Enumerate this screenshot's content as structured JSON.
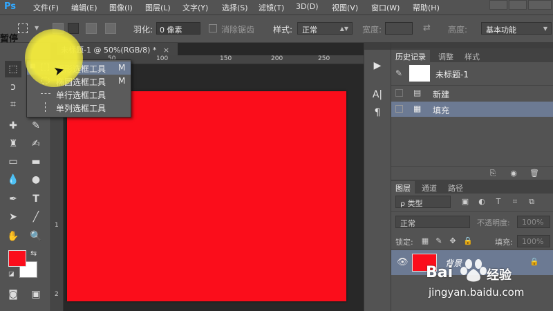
{
  "app": {
    "logo": "Ps",
    "menu": [
      "文件(F)",
      "编辑(E)",
      "图像(I)",
      "图层(L)",
      "文字(Y)",
      "选择(S)",
      "滤镜(T)",
      "3D(D)",
      "视图(V)",
      "窗口(W)",
      "帮助(H)"
    ]
  },
  "options_bar": {
    "feather_label": "羽化:",
    "feather_value": "0 像素",
    "antialias_label": "消除锯齿",
    "style_label": "样式:",
    "style_value": "正常",
    "width_label": "宽度:",
    "height_label": "高度:",
    "workspace_value": "基本功能"
  },
  "overlay": {
    "pause_label": "暂停"
  },
  "document": {
    "tab_title": "未标题-1 @ 50%(RGB/8) *",
    "close": "×",
    "ruler_h": [
      "50",
      "100",
      "150",
      "200",
      "250"
    ],
    "ruler_v": [
      "1",
      "2"
    ],
    "canvas_color": "#fb0d1b"
  },
  "flyout": {
    "items": [
      {
        "label": "矩形选框工具",
        "shortcut": "M"
      },
      {
        "label": "椭圆选框工具",
        "shortcut": "M"
      },
      {
        "label": "单行选框工具",
        "shortcut": ""
      },
      {
        "label": "单列选框工具",
        "shortcut": ""
      }
    ]
  },
  "history_panel": {
    "tabs": [
      "历史记录",
      "调整",
      "样式"
    ],
    "snapshot_label": "未标题-1",
    "items": [
      "新建",
      "填充"
    ],
    "selected_item": "填充"
  },
  "layers_panel": {
    "tabs": [
      "图层",
      "通道",
      "路径"
    ],
    "filter_label": "ρ 类型",
    "blend_mode": "正常",
    "opacity_label": "不透明度:",
    "opacity_value": "100%",
    "lock_label": "锁定:",
    "fill_label": "填充:",
    "fill_value": "100%",
    "layers": [
      {
        "name": "背景",
        "color": "#fb0d1b"
      }
    ]
  },
  "colors": {
    "foreground": "#fb0d1b",
    "background": "#ffffff",
    "accent_selection": "#6c7a93",
    "cursor_highlight": "#f4ec3c"
  },
  "watermark": {
    "brand": "Bai",
    "brand_suffix": "经验",
    "url": "jingyan.baidu.com"
  }
}
